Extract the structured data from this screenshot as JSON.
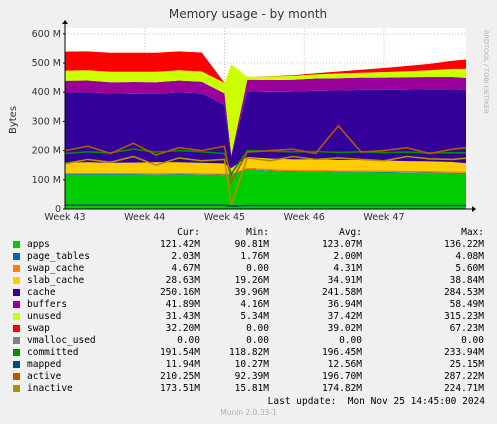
{
  "chart_data": {
    "type": "area",
    "title": "Memory usage - by month",
    "ylabel": "Bytes",
    "side_label": "RRDTOOL / TOBI OETIKER",
    "ylim": [
      0,
      620
    ],
    "yticks": [
      0,
      100,
      200,
      300,
      400,
      500,
      600
    ],
    "ytick_labels": [
      "0",
      "100 M",
      "200 M",
      "300 M",
      "400 M",
      "500 M",
      "600 M"
    ],
    "x_range": [
      0,
      35.2
    ],
    "xticks": [
      {
        "x": 0,
        "label": "Week 43"
      },
      {
        "x": 7,
        "label": "Week 44"
      },
      {
        "x": 14,
        "label": "Week 45"
      },
      {
        "x": 21,
        "label": "Week 46"
      },
      {
        "x": 28,
        "label": "Week 47"
      }
    ],
    "x_unit": "days since start of Week 43",
    "series_x": [
      0,
      2,
      4,
      6,
      8,
      10,
      12,
      14,
      14.6,
      16,
      18,
      20,
      22,
      24,
      26,
      28,
      30,
      32,
      34,
      35.2
    ],
    "stack": [
      {
        "name": "apps",
        "color": "#00cc00",
        "values": [
          118,
          118,
          118,
          118,
          117,
          118,
          117,
          116,
          118,
          135,
          130,
          128,
          127,
          126,
          126,
          125,
          124,
          123,
          122,
          121
        ]
      },
      {
        "name": "page_tables",
        "color": "#0066b3",
        "values": [
          2,
          2,
          2,
          2,
          2,
          2,
          2,
          2,
          2,
          2,
          2,
          2,
          2,
          2,
          2,
          2,
          2,
          2,
          2,
          2
        ]
      },
      {
        "name": "swap_cache",
        "color": "#ff8000",
        "values": [
          4,
          4,
          4,
          4,
          4,
          4,
          4,
          4,
          0,
          5,
          5,
          5,
          5,
          5,
          5,
          5,
          5,
          5,
          5,
          5
        ]
      },
      {
        "name": "slab_cache",
        "color": "#ffcc00",
        "values": [
          35,
          36,
          34,
          35,
          37,
          36,
          35,
          34,
          20,
          36,
          36,
          35,
          36,
          35,
          35,
          34,
          33,
          33,
          32,
          29
        ]
      },
      {
        "name": "cache",
        "color": "#330099",
        "values": [
          240,
          240,
          238,
          236,
          234,
          240,
          238,
          200,
          40,
          225,
          228,
          232,
          235,
          238,
          240,
          242,
          245,
          247,
          249,
          250
        ]
      },
      {
        "name": "buffers",
        "color": "#990099",
        "values": [
          40,
          40,
          38,
          40,
          40,
          40,
          40,
          40,
          5,
          40,
          41,
          41,
          42,
          42,
          42,
          42,
          42,
          42,
          42,
          42
        ]
      },
      {
        "name": "unused",
        "color": "#ccff00",
        "values": [
          35,
          35,
          36,
          35,
          36,
          35,
          35,
          36,
          310,
          10,
          12,
          13,
          14,
          16,
          17,
          19,
          21,
          23,
          28,
          31
        ]
      },
      {
        "name": "swap",
        "color": "#ff0000",
        "values": [
          65,
          65,
          65,
          65,
          65,
          65,
          65,
          0,
          0,
          0,
          1,
          2,
          4,
          7,
          10,
          14,
          18,
          22,
          28,
          32
        ]
      }
    ],
    "lines": [
      {
        "name": "committed",
        "color": "#008f00",
        "values": [
          190,
          196,
          192,
          205,
          195,
          200,
          196,
          190,
          120,
          200,
          198,
          196,
          197,
          194,
          196,
          193,
          195,
          192,
          193,
          192
        ]
      },
      {
        "name": "mapped",
        "color": "#00487d",
        "values": [
          13,
          13,
          13,
          13,
          13,
          13,
          13,
          13,
          10,
          12,
          12,
          12,
          12,
          12,
          12,
          12,
          12,
          12,
          12,
          12
        ]
      },
      {
        "name": "active",
        "color": "#b35a00",
        "values": [
          200,
          215,
          190,
          225,
          185,
          210,
          200,
          215,
          93,
          195,
          200,
          205,
          190,
          285,
          195,
          200,
          210,
          190,
          205,
          210
        ]
      },
      {
        "name": "inactive",
        "color": "#b38f00",
        "values": [
          155,
          170,
          160,
          180,
          150,
          175,
          165,
          170,
          15,
          175,
          165,
          180,
          170,
          175,
          170,
          165,
          180,
          172,
          170,
          174
        ]
      }
    ],
    "legend_headers": [
      "Cur:",
      "Min:",
      "Avg:",
      "Max:"
    ],
    "legend": [
      {
        "name": "apps",
        "color": "#00cc00",
        "cur": "121.42M",
        "min": "90.81M",
        "avg": "123.07M",
        "max": "136.22M"
      },
      {
        "name": "page_tables",
        "color": "#0066b3",
        "cur": "2.03M",
        "min": "1.76M",
        "avg": "2.00M",
        "max": "4.08M"
      },
      {
        "name": "swap_cache",
        "color": "#ff8000",
        "cur": "4.67M",
        "min": "0.00",
        "avg": "4.31M",
        "max": "5.60M"
      },
      {
        "name": "slab_cache",
        "color": "#ffcc00",
        "cur": "28.63M",
        "min": "19.26M",
        "avg": "34.91M",
        "max": "38.84M"
      },
      {
        "name": "cache",
        "color": "#330099",
        "cur": "250.16M",
        "min": "39.96M",
        "avg": "241.58M",
        "max": "284.53M"
      },
      {
        "name": "buffers",
        "color": "#990099",
        "cur": "41.89M",
        "min": "4.16M",
        "avg": "36.94M",
        "max": "58.49M"
      },
      {
        "name": "unused",
        "color": "#ccff00",
        "cur": "31.43M",
        "min": "5.34M",
        "avg": "37.42M",
        "max": "315.23M"
      },
      {
        "name": "swap",
        "color": "#ff0000",
        "cur": "32.20M",
        "min": "0.00",
        "avg": "39.02M",
        "max": "67.23M"
      },
      {
        "name": "vmalloc_used",
        "color": "#808080",
        "cur": "0.00",
        "min": "0.00",
        "avg": "0.00",
        "max": "0.00"
      },
      {
        "name": "committed",
        "color": "#008f00",
        "cur": "191.54M",
        "min": "118.82M",
        "avg": "196.45M",
        "max": "233.94M"
      },
      {
        "name": "mapped",
        "color": "#00487d",
        "cur": "11.94M",
        "min": "10.27M",
        "avg": "12.56M",
        "max": "25.15M"
      },
      {
        "name": "active",
        "color": "#b35a00",
        "cur": "210.25M",
        "min": "92.39M",
        "avg": "196.70M",
        "max": "287.22M"
      },
      {
        "name": "inactive",
        "color": "#b38f00",
        "cur": "173.51M",
        "min": "15.81M",
        "avg": "174.82M",
        "max": "224.71M"
      }
    ]
  },
  "footer": {
    "last_update": "Last update:  Mon Nov 25 14:45:00 2024",
    "version": "Munin 2.0.33-1"
  }
}
